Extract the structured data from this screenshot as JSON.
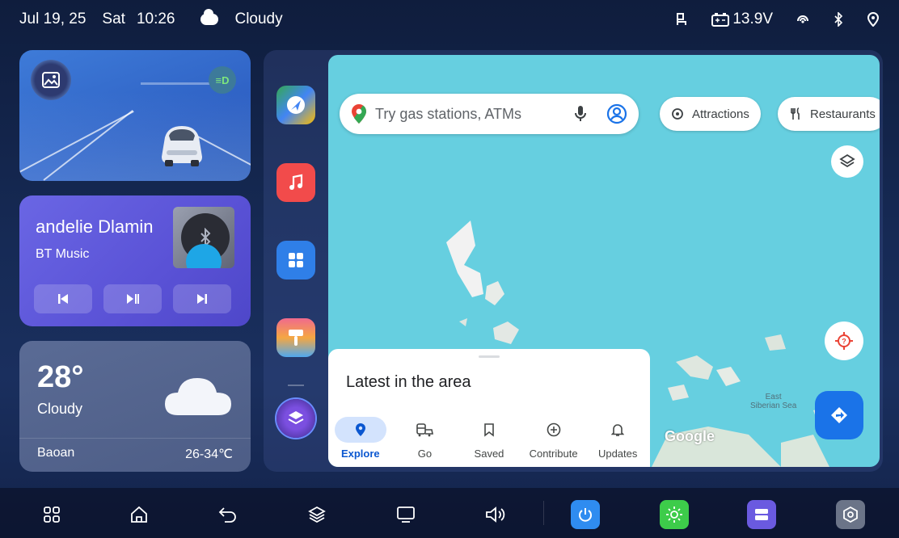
{
  "status_bar": {
    "date": "Jul 19, 25",
    "day": "Sat",
    "time": "10:26",
    "weather": "Cloudy",
    "voltage": "13.9V",
    "icons": [
      "seat-icon",
      "battery-icon",
      "signal-icon",
      "bluetooth-icon",
      "location-pin-icon"
    ]
  },
  "car_card": {
    "icons": [
      "gallery-icon",
      "headlight-icon"
    ],
    "headlight_label": "≡D"
  },
  "music_card": {
    "title": "andelie Dlamin",
    "source": "BT Music",
    "icons": [
      "previous-icon",
      "play-pause-icon",
      "next-icon",
      "bluetooth-icon"
    ]
  },
  "weather_card": {
    "temperature": "28°",
    "condition": "Cloudy",
    "city": "Baoan",
    "range": "26-34℃"
  },
  "dock": {
    "apps": [
      "maps-app-icon",
      "music-app-icon",
      "apps-grid-icon",
      "paint-app-icon",
      "layers-app-icon"
    ]
  },
  "map": {
    "search_placeholder": "Try gas stations, ATMs",
    "chips": [
      "Attractions",
      "Restaurants"
    ],
    "region_label_line1": "East",
    "region_label_line2": "Siberian Sea",
    "logo": "Google",
    "sheet_title": "Latest in the area",
    "nav": [
      {
        "label": "Explore",
        "icon": "explore-pin-icon",
        "active": true
      },
      {
        "label": "Go",
        "icon": "commute-icon",
        "active": false
      },
      {
        "label": "Saved",
        "icon": "bookmark-icon",
        "active": false
      },
      {
        "label": "Contribute",
        "icon": "add-circle-icon",
        "active": false
      },
      {
        "label": "Updates",
        "icon": "bell-icon",
        "active": false
      }
    ],
    "colors": {
      "water": "#66cfe0",
      "accent": "#1a73e8"
    }
  },
  "bottom_bar": {
    "icons": [
      "home-grid-icon",
      "home-icon",
      "back-icon",
      "layers-icon",
      "screen-icon",
      "volume-icon",
      "power-icon",
      "brightness-icon",
      "storage-icon",
      "settings-icon"
    ],
    "colors": {
      "power": "#2f8cf0",
      "brightness": "#3dcc4a",
      "storage": "#6a5ae0",
      "settings": "#6b7488"
    }
  }
}
